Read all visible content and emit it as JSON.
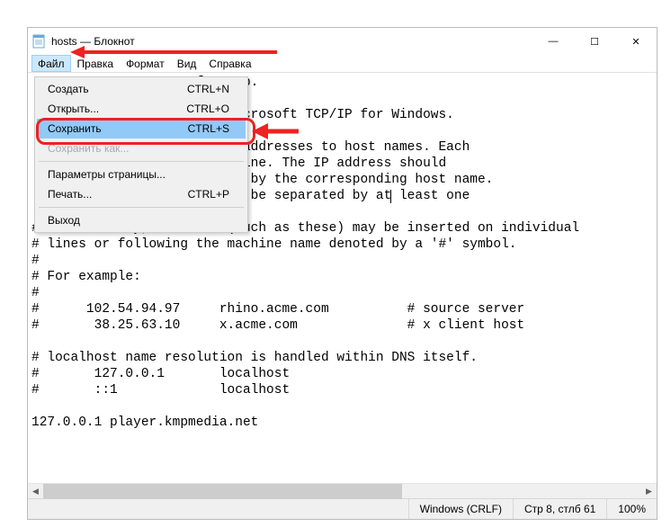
{
  "title": "hosts — Блокнот",
  "menubar": [
    "Файл",
    "Правка",
    "Формат",
    "Вид",
    "Справка"
  ],
  "dropdown": {
    "create": {
      "label": "Создать",
      "shortcut": "CTRL+N"
    },
    "open": {
      "label": "Открыть...",
      "shortcut": "CTRL+O"
    },
    "save": {
      "label": "Сохранить",
      "shortcut": "CTRL+S"
    },
    "saveas": {
      "label": "Сохранить как..."
    },
    "pagesetup": {
      "label": "Параметры страницы..."
    },
    "print": {
      "label": "Печать...",
      "shortcut": "CTRL+P"
    },
    "exit": {
      "label": "Выход"
    }
  },
  "editor_lines": [
    "                    oft Corp.",
    "",
    "                   ed by Microsoft TCP/IP for Windows.",
    "",
    "                   s of IP addresses to host names. Each",
    "                   vidual line. The IP address should",
    "                   followed by the corresponding host name.",
    "                   e should be separated by at| least one",
    "",
    "# Additionally, comments (such as these) may be inserted on individual",
    "# lines or following the machine name denoted by a '#' symbol.",
    "#",
    "# For example:",
    "#",
    "#      102.54.94.97     rhino.acme.com          # source server",
    "#       38.25.63.10     x.acme.com              # x client host",
    "",
    "# localhost name resolution is handled within DNS itself.",
    "#       127.0.0.1       localhost",
    "#       ::1             localhost",
    "",
    "127.0.0.1 player.kmpmedia.net"
  ],
  "status": {
    "encoding": "Windows (CRLF)",
    "position": "Стр 8, стлб 61",
    "zoom": "100%"
  },
  "win_controls": {
    "min": "—",
    "max": "☐",
    "close": "✕"
  },
  "arrows": {
    "left": "◀",
    "right": "▶"
  }
}
